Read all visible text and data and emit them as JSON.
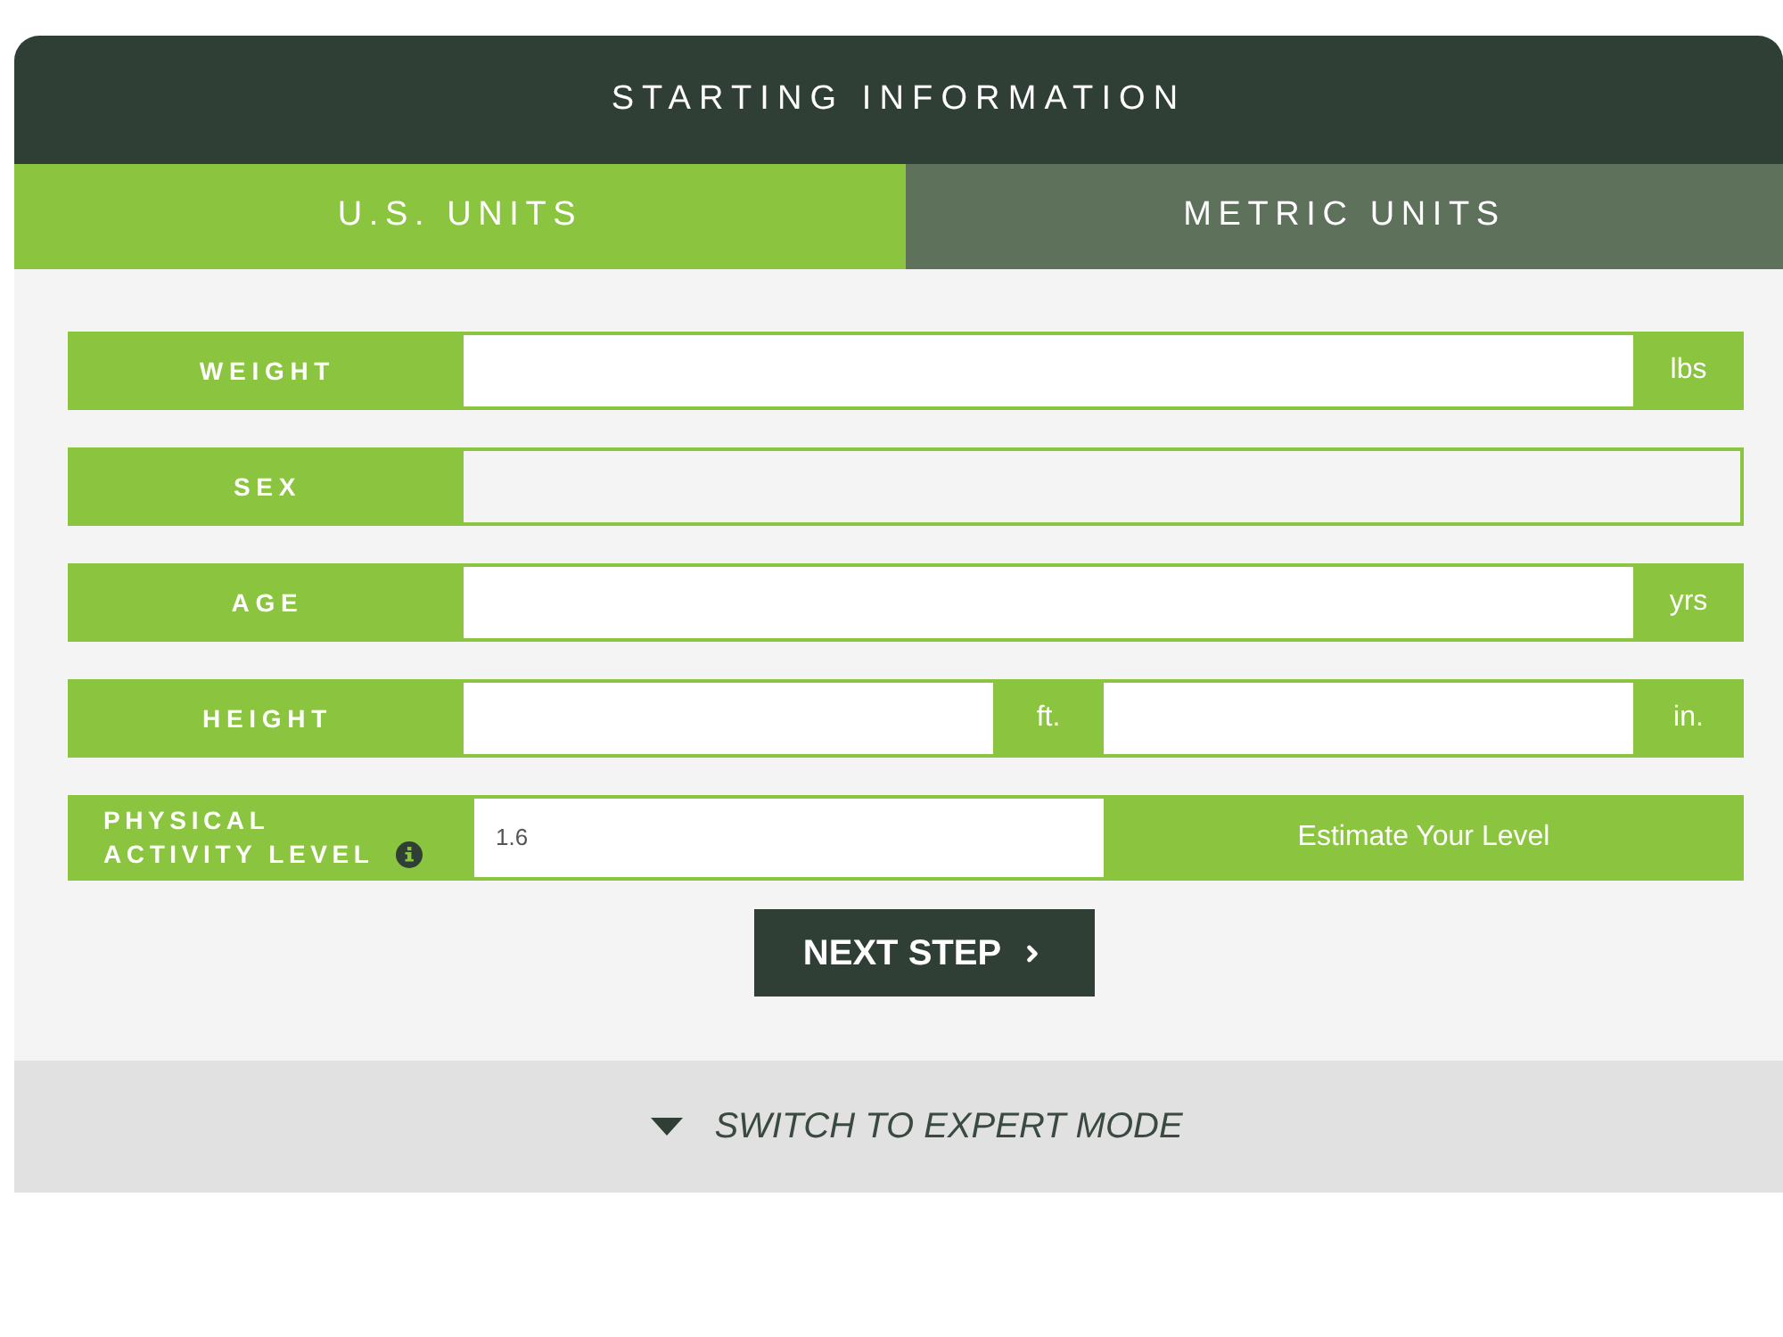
{
  "header": {
    "title": "STARTING INFORMATION"
  },
  "tabs": [
    {
      "label": "U.S. UNITS",
      "selected": true
    },
    {
      "label": "METRIC UNITS",
      "selected": false
    }
  ],
  "fields": [
    {
      "kind": "input",
      "label": "WEIGHT",
      "unit": "lbs"
    },
    {
      "kind": "select",
      "label": "SEX"
    },
    {
      "kind": "input",
      "label": "AGE",
      "unit": "yrs"
    },
    {
      "kind": "split",
      "label": "HEIGHT",
      "parts": [
        {
          "unit": "ft."
        },
        {
          "unit": "in."
        }
      ]
    },
    {
      "kind": "activity",
      "label": "PHYSICAL ACTIVITY LEVEL",
      "value": "1.6",
      "button": "Estimate Your Level"
    }
  ],
  "next_button": {
    "label": "NEXT STEP"
  },
  "expert_toggle": {
    "label": "SWITCH TO EXPERT MODE",
    "expanded": false
  }
}
